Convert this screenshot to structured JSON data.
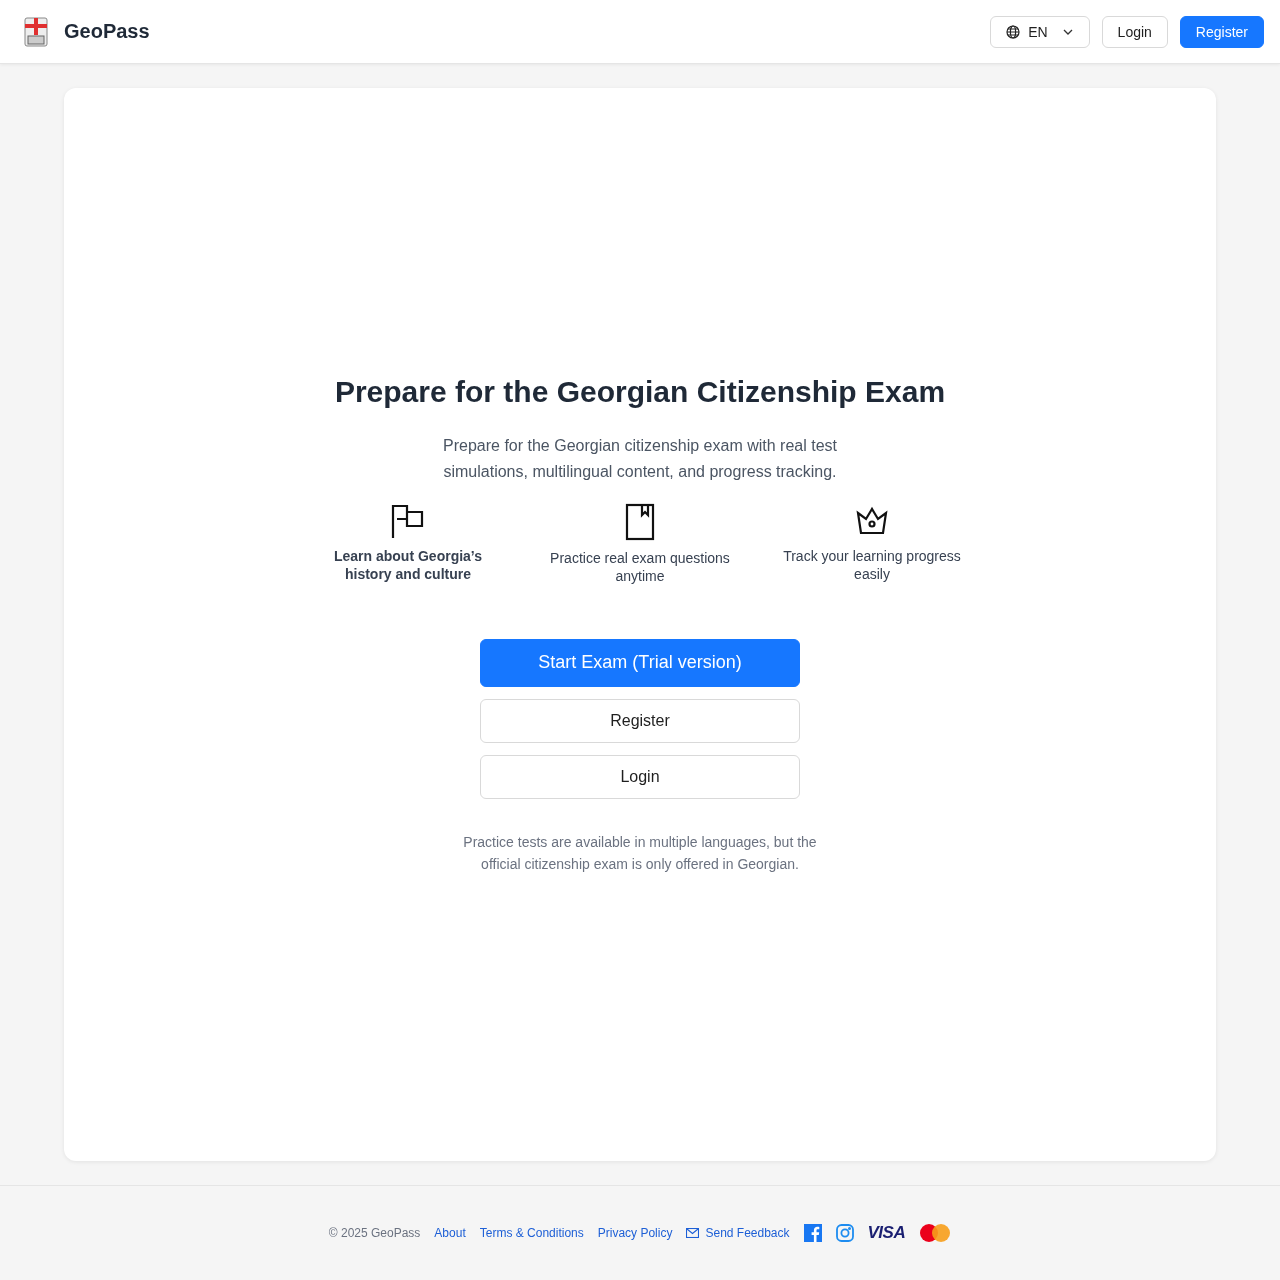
{
  "header": {
    "brand": "GeoPass",
    "language": "EN",
    "login": "Login",
    "register": "Register"
  },
  "hero": {
    "title": "Prepare for the Georgian Citizenship Exam",
    "subtitle": "Prepare for the Georgian citizenship exam with real test simulations, multilingual content, and progress tracking.",
    "features": [
      {
        "kind": "flag",
        "text": "Learn about Georgia’s history and culture",
        "emphasized": true
      },
      {
        "kind": "book",
        "text": "Practice real exam questions anytime",
        "emphasized": false
      },
      {
        "kind": "crown",
        "text": "Track your learning progress easily",
        "emphasized": false
      }
    ],
    "start_button": "Start Exam (Trial version)",
    "register_button": "Register",
    "login_button": "Login",
    "note": "Practice tests are available in multiple languages, but the official citizenship exam is only offered in Georgian."
  },
  "footer": {
    "copyright": "© 2025 GeoPass",
    "links": [
      "About",
      "Terms & Conditions",
      "Privacy Policy"
    ],
    "feedback": "Send Feedback",
    "visa": "VISA"
  }
}
